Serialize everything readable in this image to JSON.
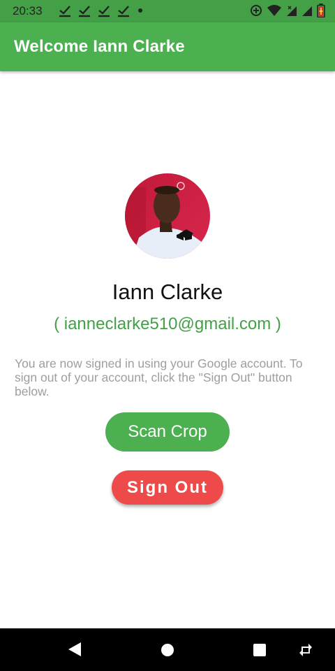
{
  "status_bar": {
    "time": "20:33",
    "icons": [
      "check-icon",
      "check-icon",
      "check-icon",
      "check-icon",
      "dot-icon",
      "data-saver-icon",
      "wifi-icon",
      "signal-icon",
      "signal-icon",
      "battery-icon"
    ]
  },
  "app_bar": {
    "title": "Welcome Iann Clarke"
  },
  "profile": {
    "name": "Iann Clarke",
    "email": "( ianneclarke510@gmail.com )",
    "info": "You are now signed in using your Google account. To sign out of your account, click the \"Sign Out\" button below."
  },
  "buttons": {
    "scan_crop": "Scan Crop",
    "sign_out": "Sign Out"
  },
  "nav_bar": {
    "icons": [
      "back-icon",
      "home-icon",
      "recents-icon",
      "rotate-icon"
    ]
  },
  "colors": {
    "primary": "#4caf50",
    "status_bar": "#43a047",
    "sign_out": "#ef4a4a",
    "email": "#43a047"
  }
}
